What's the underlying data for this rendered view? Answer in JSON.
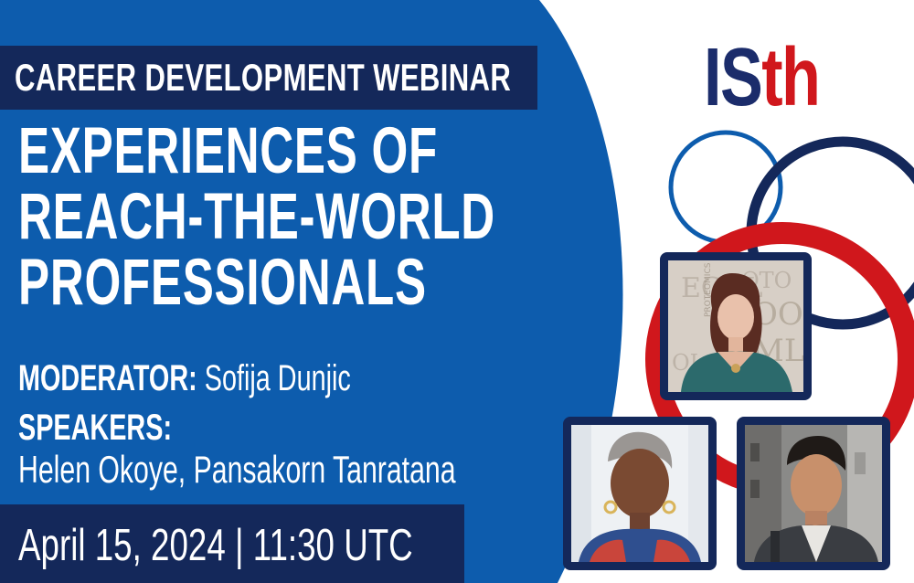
{
  "tag_label": "CAREER DEVELOPMENT WEBINAR",
  "title_lines": [
    "EXPERIENCES OF",
    "REACH-THE-WORLD",
    "PROFESSIONALS"
  ],
  "moderator": {
    "label": "MODERATOR:",
    "name": "Sofija Dunjic"
  },
  "speakers": {
    "label": "SPEAKERS:",
    "names": "Helen Okoye, Pansakorn Tanratana"
  },
  "date_line": "April 15, 2024 | 11:30 UTC",
  "logo": {
    "part1": "IS",
    "part2": "th"
  },
  "colors": {
    "blue": "#0d5cad",
    "navy": "#14285a",
    "red": "#d0171c",
    "logo_navy": "#1b2c6b"
  },
  "photos": [
    {
      "subject": "moderator-photo",
      "backdrop_text": "PROTEOMICS"
    },
    {
      "subject": "speaker-photo-helen"
    },
    {
      "subject": "speaker-photo-pansakorn"
    }
  ]
}
